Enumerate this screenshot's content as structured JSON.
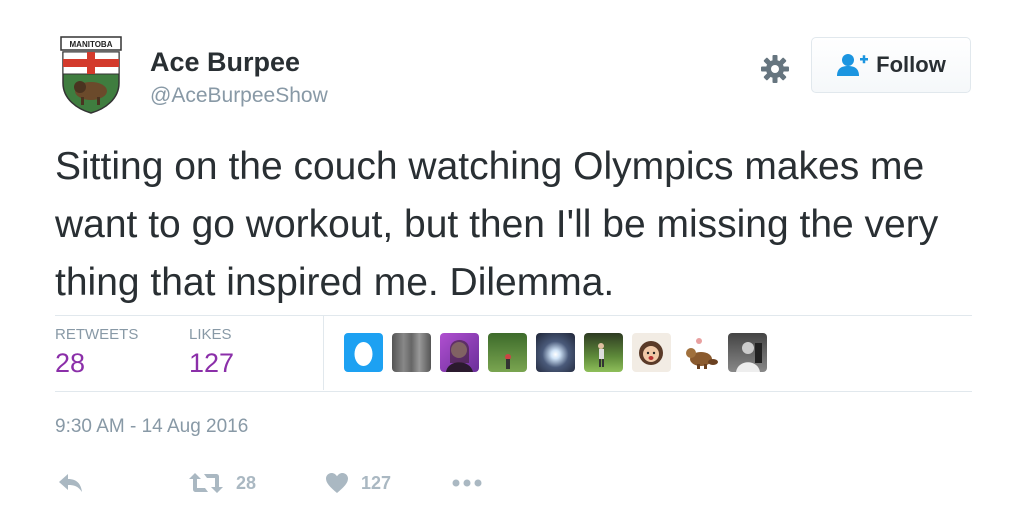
{
  "profile": {
    "avatar_text": "MANITOBA",
    "name": "Ace Burpee",
    "handle": "@AceBurpeeShow"
  },
  "follow_button": {
    "label": "Follow"
  },
  "tweet": {
    "text": "Sitting on the couch watching Olympics makes me want to go workout, but then I'll be missing the very thing that inspired me. Dilemma."
  },
  "stats": {
    "retweets_label": "RETWEETS",
    "retweets_value": "28",
    "likes_label": "LIKES",
    "likes_value": "127"
  },
  "timestamp": "9:30 AM - 14 Aug 2016",
  "actions": {
    "retweet_count": "28",
    "like_count": "127"
  },
  "icons": [
    "gear-icon",
    "add-user-icon",
    "reply-icon",
    "retweet-icon",
    "heart-icon",
    "more-icon"
  ],
  "colors": {
    "accent": "#8b2fa9",
    "muted": "#8899a6",
    "text": "#292f33",
    "action": "#aab8c2"
  }
}
